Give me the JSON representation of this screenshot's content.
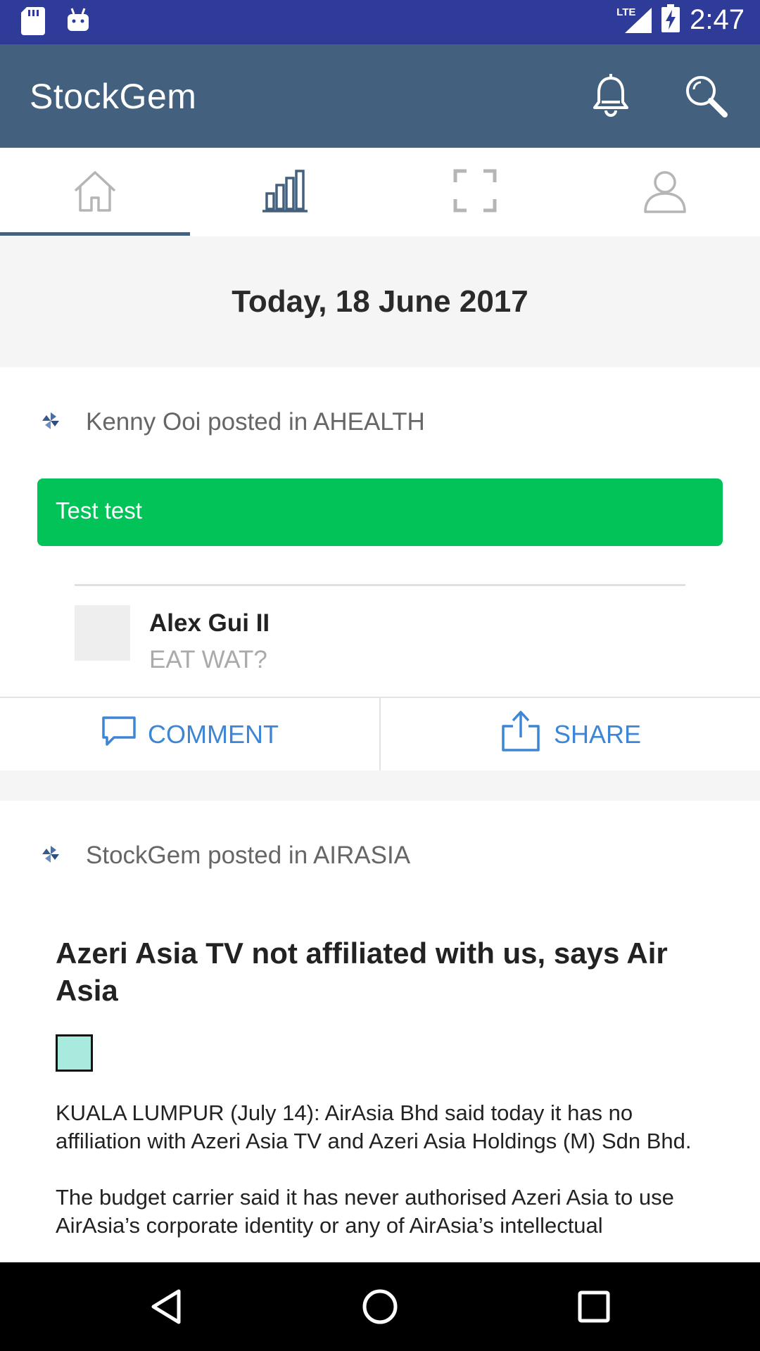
{
  "status_bar": {
    "time": "2:47",
    "network": "LTE",
    "icons": [
      "sd-card-icon",
      "android-icon",
      "signal-icon",
      "battery-charging-icon"
    ]
  },
  "app_bar": {
    "title": "StockGem",
    "actions": [
      "bell-icon",
      "search-icon"
    ]
  },
  "tabs": [
    {
      "icon": "home-icon",
      "selected": true
    },
    {
      "icon": "bar-chart-icon",
      "selected": false
    },
    {
      "icon": "fullscreen-icon",
      "selected": false
    },
    {
      "icon": "user-icon",
      "selected": false
    }
  ],
  "feed": {
    "date": "Today, 18 June 2017",
    "posts": [
      {
        "poster": "Kenny Ooi posted in AHEALTH",
        "message": "Test test",
        "comment": {
          "author": "Alex Gui II",
          "text": "EAT WAT?"
        },
        "actions": {
          "comment_label": "COMMENT",
          "share_label": "SHARE"
        }
      },
      {
        "poster": "StockGem posted in AIRASIA",
        "title": "Azeri Asia TV not affiliated with us, says Air Asia",
        "paragraphs": [
          "KUALA LUMPUR (July 14): AirAsia Bhd said today it has no affiliation with Azeri Asia TV and Azeri Asia Holdings (M) Sdn Bhd.",
          "The budget carrier said it has never authorised Azeri Asia to use AirAsia’s corporate identity or any of AirAsia’s intellectual"
        ]
      }
    ]
  },
  "colors": {
    "status_bar": "#2e3b99",
    "app_bar": "#43617f",
    "green": "#01c358",
    "link_blue": "#3d86d6"
  }
}
